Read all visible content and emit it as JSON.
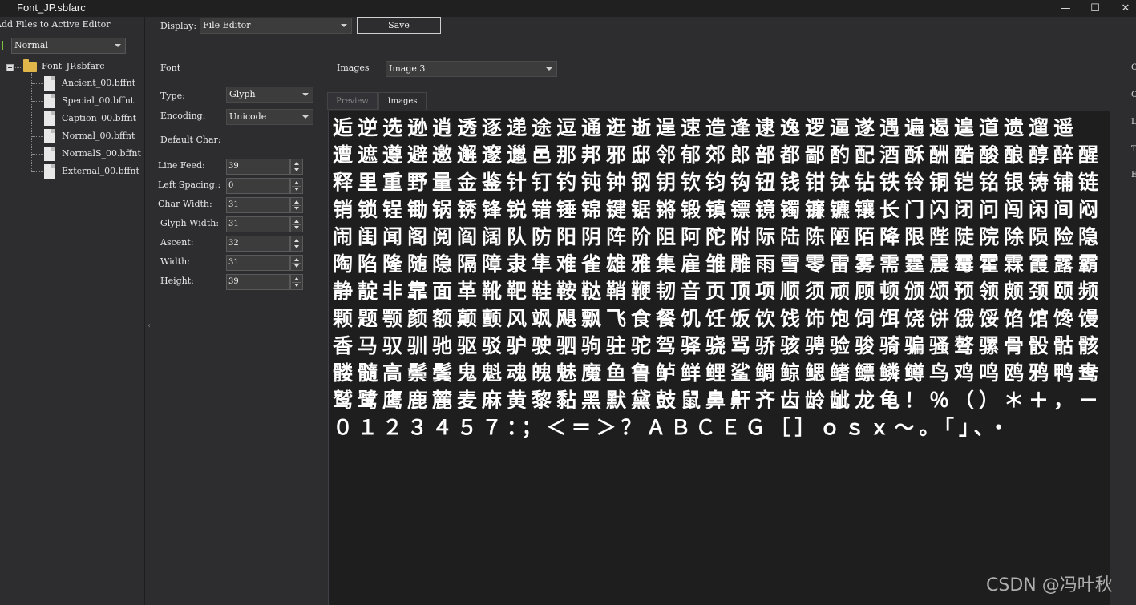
{
  "window": {
    "title": "Font_JP.sbfarc",
    "minimize_glyph": "—",
    "maximize_glyph": "☐",
    "close_glyph": "✕"
  },
  "sidebar": {
    "add_files_label": "Add Files to Active Editor",
    "mode_select": "Normal",
    "tree_root": "Font_JP.sbfarc",
    "files": [
      "Ancient_00.bffnt",
      "Special_00.bffnt",
      "Caption_00.bffnt",
      "Normal_00.bffnt",
      "NormalS_00.bffnt",
      "External_00.bffnt"
    ]
  },
  "toolbar": {
    "display_label": "Display:",
    "display_value": "File Editor",
    "save_label": "Save"
  },
  "font_panel": {
    "section_label": "Font",
    "type_label": "Type:",
    "type_value": "Glyph",
    "encoding_label": "Encoding:",
    "encoding_value": "Unicode",
    "default_char_label": "Default Char:",
    "fields": [
      {
        "label": "Line Feed:",
        "value": "39"
      },
      {
        "label": "Left Spacing::",
        "value": "0"
      },
      {
        "label": "Char Width:",
        "value": "31"
      },
      {
        "label": "Glyph Width:",
        "value": "31"
      },
      {
        "label": "Ascent:",
        "value": "32"
      },
      {
        "label": "Width:",
        "value": "31"
      },
      {
        "label": "Height:",
        "value": "39"
      }
    ]
  },
  "images_panel": {
    "images_label": "Images",
    "images_value": "Image 3",
    "tabs": [
      "Preview",
      "Images"
    ],
    "active_tab": "Images",
    "glyph_rows": [
      "逅逆选逊逍透逐递途逗通逛逝逞速造逢逮逸逻逼遂遇遍遏遑道遗遛遥",
      "遭遮遵避邀邂邃邋邑那邦邪邸邻郁郊郎部都鄙酌配酒酥酬酷酸酿醇醉醒",
      "释里重野量金鉴针钉钓钝钟钢钥钦钧钩钮钱钳钵钻铁铃铜铠铭银铸铺链",
      "销锁锃锄锅锈锋锐错锤锦键锯锵锻镇镖镜镯镰镳镶长门闪闭问闯闲间闷",
      "闹闺闻阁阅阎阔队防阳阴阵阶阻阿陀附际陆陈陋陌降限陛陡院除陨险隐",
      "陶陷隆随隐隔障隶隼难雀雄雅集雇雏雕雨雪零雷雾需霆震霉霍霖霞露霸",
      "静靛非靠面革靴靶鞋鞍鞑鞘鞭韧音页顶项顺须顽顾顿颁颂预领颇颈颐频",
      "颗题颚颜额颠颤风飒飓飘飞食餐饥饪饭饮饯饰饱饲饵饶饼饿馁馅馆馋馒",
      "香马驭驯驰驱驳驴驶驷驹驻驼驾驿骁骂骄骇骋验骏骑骗骚骜骡骨骰骷骸",
      "髅髓高鬃鬓鬼魁魂魄魅魔鱼鲁鲈鲜鲤鲨鲷鲸鳃鳍鳔鳞鳟鸟鸡鸣鸥鸦鸭鸯",
      "鹫鹭鹰鹿麓麦麻黄黎黏黑默黛鼓鼠鼻鼾齐齿龄龇龙龟！％（）＊＋，－",
      "０１２３４５７：；＜＝＞？ＡＢＣＥＧ［］ｏｓｘ～。「」、・"
    ]
  },
  "right_edge_letters": [
    "C",
    "C",
    "L",
    "T",
    "E"
  ],
  "watermark": "CSDN @冯叶秋"
}
